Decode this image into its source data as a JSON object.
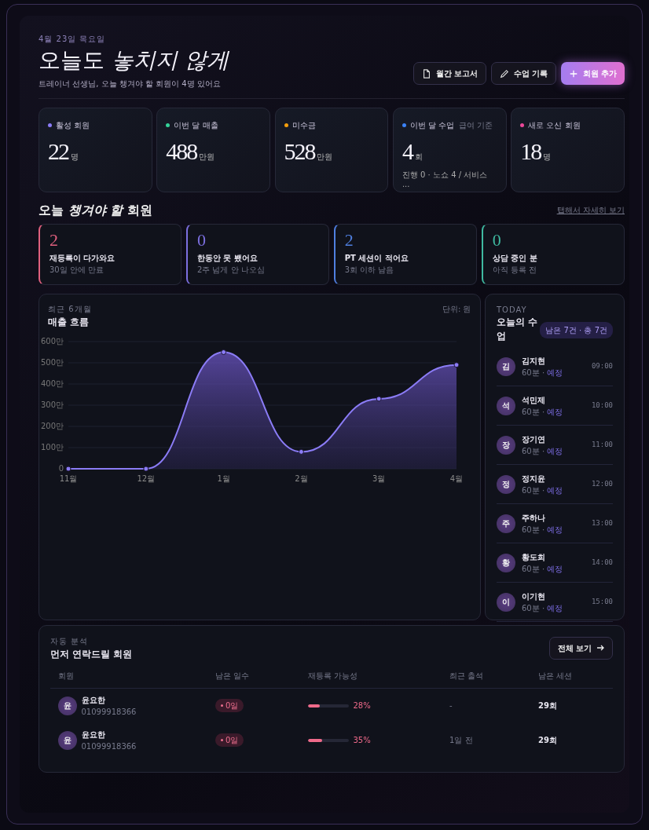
{
  "header": {
    "date": "4월 23일 목요일",
    "title": "오늘도 *놓치지 않게*",
    "subtitle": "트레이너 선생님, 오늘 챙겨야 할 회원이 4명 있어요",
    "buttons": [
      {
        "label": "월간 보고서",
        "kind": "report"
      },
      {
        "label": "수업 기록",
        "kind": "record"
      },
      {
        "label": "회원 추가",
        "kind": "add"
      }
    ]
  },
  "stats": [
    {
      "label": "활성 회원",
      "value": "22",
      "unit": "명",
      "color": "#8b7cf6"
    },
    {
      "label": "이번 달 매출",
      "value": "488",
      "unit": "만원",
      "color": "#34d399"
    },
    {
      "label": "미수금",
      "value": "528",
      "unit": "만원",
      "color": "#f59e0b"
    },
    {
      "label": "이번 달 수업",
      "note": "급여 기준",
      "value": "4",
      "unit": "회",
      "detail": "진행 0 · 노쇼 4 / 서비스 ...",
      "color": "#3b82f6"
    },
    {
      "label": "새로 오신 회원",
      "value": "18",
      "unit": "명",
      "color": "#ec4899"
    }
  ],
  "attention": {
    "title": "오늘 *챙겨야 할* 회원",
    "hint": "탭해서 자세히 보기",
    "items": [
      {
        "count": "2",
        "label": "재등록이 다가와요",
        "sub": "30일 안에 만료",
        "color": "#e0607e"
      },
      {
        "count": "0",
        "label": "한동안 못 뵀어요",
        "sub": "2주 넘게 안 나오심",
        "color": "#7c6fe0"
      },
      {
        "count": "2",
        "label": "PT 세션이 적어요",
        "sub": "3회 이하 남음",
        "color": "#4f7fe0"
      },
      {
        "count": "0",
        "label": "상담 중인 분",
        "sub": "아직 등록 전",
        "color": "#3fb9a0"
      }
    ]
  },
  "revenue": {
    "eyebrow": "최근 6개월",
    "title": "매출 흐름",
    "unit": "단위: 원",
    "chart_data": {
      "type": "area",
      "categories": [
        "11월",
        "12월",
        "1월",
        "2월",
        "3월",
        "4월"
      ],
      "series": [
        {
          "color": "#8b7cf6",
          "values": [
            0,
            0,
            550,
            80,
            330,
            490
          ]
        }
      ],
      "grid": true,
      "ylim": [
        0,
        600
      ],
      "yticks": [
        {
          "value": 0,
          "label": "0"
        },
        {
          "value": 100,
          "label": "100만"
        },
        {
          "value": 200,
          "label": "200만"
        },
        {
          "value": 300,
          "label": "300만"
        },
        {
          "value": 400,
          "label": "400만"
        },
        {
          "value": 500,
          "label": "500만"
        },
        {
          "value": 600,
          "label": "600만"
        }
      ]
    }
  },
  "today": {
    "eyebrow": "TODAY",
    "title": "오늘의 수업",
    "badge": "남은 7건 · 총 7건",
    "classes": [
      {
        "initial": "김",
        "name": "김지현",
        "duration": "60분 · ",
        "status": "예정",
        "time": "09:00"
      },
      {
        "initial": "석",
        "name": "석민제",
        "duration": "60분 · ",
        "status": "예정",
        "time": "10:00"
      },
      {
        "initial": "장",
        "name": "장기연",
        "duration": "60분 · ",
        "status": "예정",
        "time": "11:00"
      },
      {
        "initial": "정",
        "name": "정지윤",
        "duration": "60분 · ",
        "status": "예정",
        "time": "12:00"
      },
      {
        "initial": "주",
        "name": "주하나",
        "duration": "60분 · ",
        "status": "예정",
        "time": "13:00"
      },
      {
        "initial": "황",
        "name": "황도희",
        "duration": "60분 · ",
        "status": "예정",
        "time": "14:00"
      },
      {
        "initial": "이",
        "name": "이기현",
        "duration": "60분 · ",
        "status": "예정",
        "time": "15:00"
      }
    ]
  },
  "contacts": {
    "eyebrow": "자동 분석",
    "title": "먼저 연락드릴 회원",
    "button": "전체 보기",
    "columns": [
      "회원",
      "남은 일수",
      "재등록 가능성",
      "최근 출석",
      "남은 세션"
    ],
    "rows": [
      {
        "initial": "윤",
        "name": "윤요한",
        "phone": "01099918366",
        "days": "0일",
        "level": 0.28,
        "percent": "28%",
        "last": "-",
        "sessions": "29회"
      },
      {
        "initial": "윤",
        "name": "윤요한",
        "phone": "01099918366",
        "days": "0일",
        "level": 0.35,
        "percent": "35%",
        "last": "1일 전",
        "sessions": "29회"
      }
    ]
  }
}
